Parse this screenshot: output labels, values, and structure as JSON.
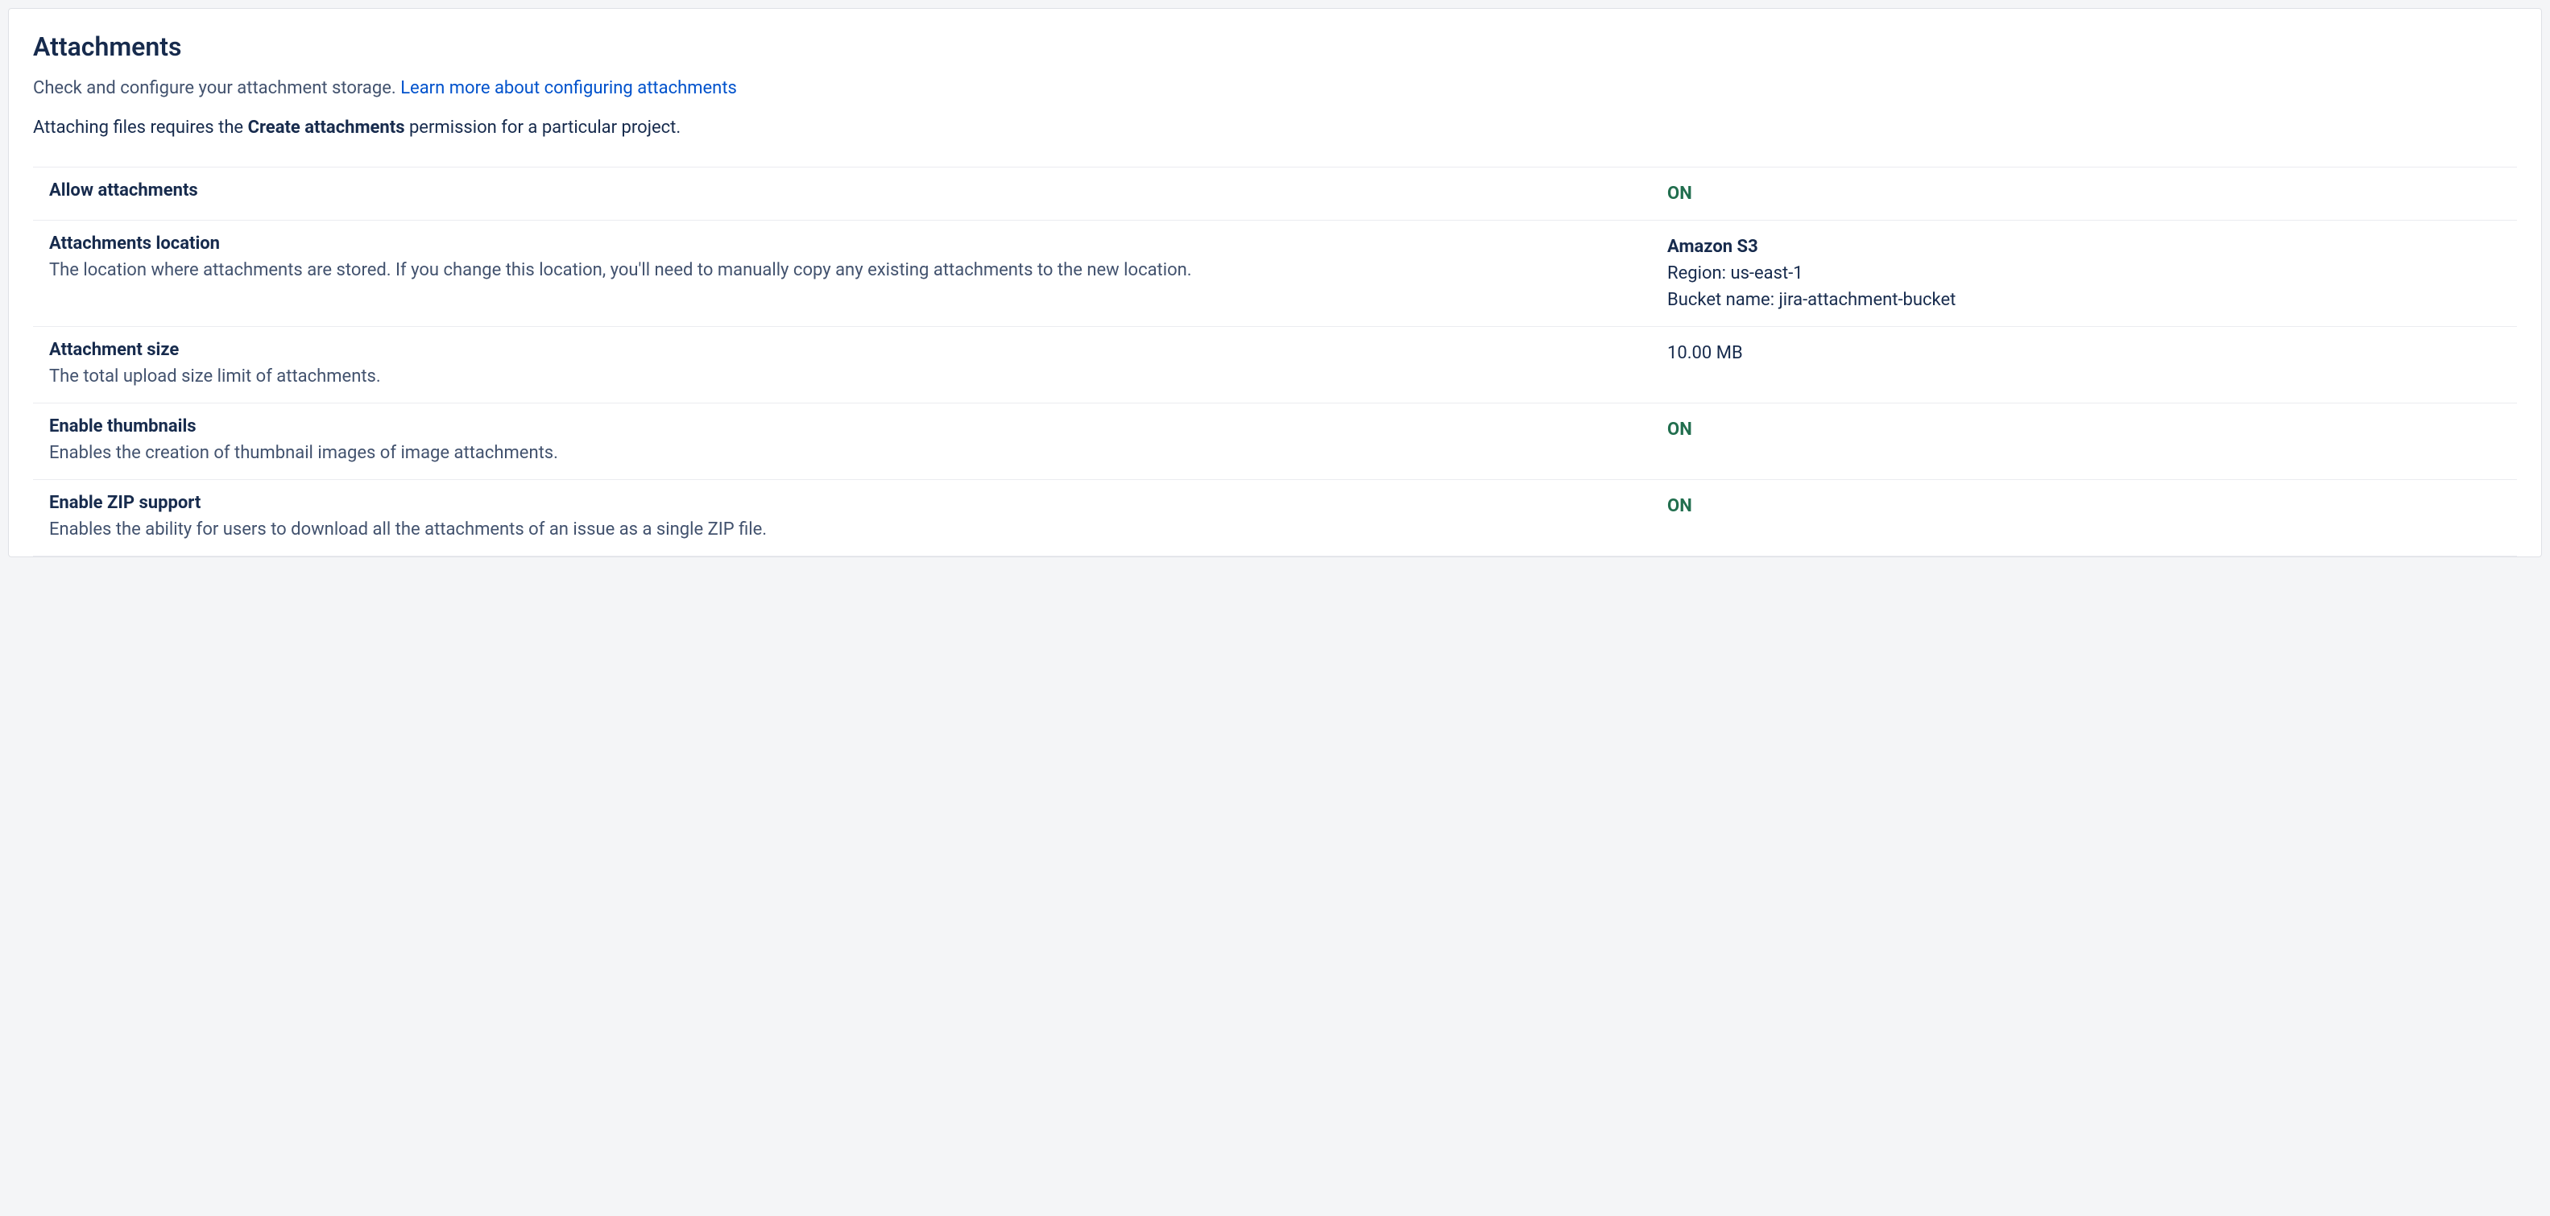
{
  "header": {
    "title": "Attachments",
    "subtitle_text": "Check and configure your attachment storage. ",
    "subtitle_link": "Learn more about configuring attachments",
    "note_before": "Attaching files requires the ",
    "note_strong": "Create attachments",
    "note_after": " permission for a particular project."
  },
  "settings": {
    "allow": {
      "name": "Allow attachments",
      "value": "ON"
    },
    "location": {
      "name": "Attachments location",
      "desc": "The location where attachments are stored. If you change this location, you'll need to manually copy any existing attachments to the new location.",
      "value_title": "Amazon S3",
      "region_label": "Region: ",
      "region_value": "us-east-1",
      "bucket_label": "Bucket name: ",
      "bucket_value": "jira-attachment-bucket"
    },
    "size": {
      "name": "Attachment size",
      "desc": "The total upload size limit of attachments.",
      "value": "10.00 MB"
    },
    "thumbnails": {
      "name": "Enable thumbnails",
      "desc": "Enables the creation of thumbnail images of image attachments.",
      "value": "ON"
    },
    "zip": {
      "name": "Enable ZIP support",
      "desc": "Enables the ability for users to download all the attachments of an issue as a single ZIP file.",
      "value": "ON"
    }
  }
}
